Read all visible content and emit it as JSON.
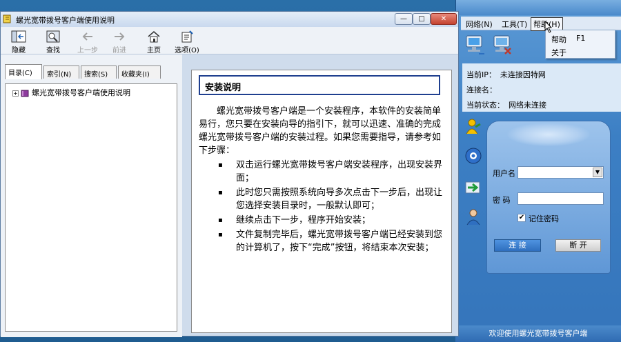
{
  "help_window": {
    "title": "螺光宽带拨号客户端使用说明",
    "controls": {
      "minimize": "—",
      "maximize": "□",
      "close": "✕"
    },
    "toolbar": [
      {
        "id": "hide",
        "label": "隐藏",
        "icon": "hide-icon",
        "enabled": true
      },
      {
        "id": "find",
        "label": "查找",
        "icon": "find-icon",
        "enabled": true
      },
      {
        "id": "back",
        "label": "上一步",
        "icon": "back-arrow-icon",
        "enabled": false
      },
      {
        "id": "forward",
        "label": "前进",
        "icon": "forward-arrow-icon",
        "enabled": false
      },
      {
        "id": "home",
        "label": "主页",
        "icon": "home-icon",
        "enabled": true
      },
      {
        "id": "options",
        "label": "选项(O)",
        "icon": "options-icon",
        "enabled": true
      }
    ],
    "tabs": [
      {
        "label": "目录(C)",
        "active": true
      },
      {
        "label": "索引(N)",
        "active": false
      },
      {
        "label": "搜索(S)",
        "active": false
      },
      {
        "label": "收藏夹(I)",
        "active": false
      }
    ],
    "tree": {
      "expander": "+",
      "root_label": "螺光宽带拨号客户端使用说明"
    },
    "topic": {
      "title": "安装说明",
      "intro": "螺光宽带拨号客户端是一个安装程序，本软件的安装简单易行，您只要在安装向导的指引下，就可以迅速、准确的完成螺光宽带拨号客户端的安装过程。如果您需要指导，请参考如下步骤：",
      "steps": [
        "双击运行螺光宽带拨号客户端安装程序，出现安装界面；",
        "此时您只需按照系统向导多次点击下一步后，出现让您选择安装目录时，一般默认即可；",
        "继续点击下一步，程序开始安装；",
        "文件复制完毕后，螺光宽带拨号客户端已经安装到您的计算机了，按下“完成”按钮，将结束本次安装；"
      ]
    }
  },
  "client": {
    "menu": [
      {
        "label": "网络(N)",
        "active": false
      },
      {
        "label": "工具(T)",
        "active": false
      },
      {
        "label": "帮助(H)",
        "active": true
      }
    ],
    "help_menu": {
      "help_label": "帮助",
      "help_shortcut": "F1",
      "about_label": "关于"
    },
    "status": {
      "ip_label": "当前IP：",
      "ip_value": "未连接因特网",
      "conn_label": "连接名：",
      "conn_value": "",
      "state_label": "当前状态：",
      "state_value": "网络未连接"
    },
    "login": {
      "username_label": "用户名",
      "username_value": "",
      "password_label": "密  码",
      "password_value": "",
      "remember_label": "记住密码",
      "remember_checked": true,
      "connect_label": "连  接",
      "disconnect_label": "断  开"
    },
    "footer": "欢迎使用螺光宽带拨号客户端",
    "colors": {
      "accent": "#3c7fc4",
      "title_border": "#1f3f8f"
    }
  }
}
